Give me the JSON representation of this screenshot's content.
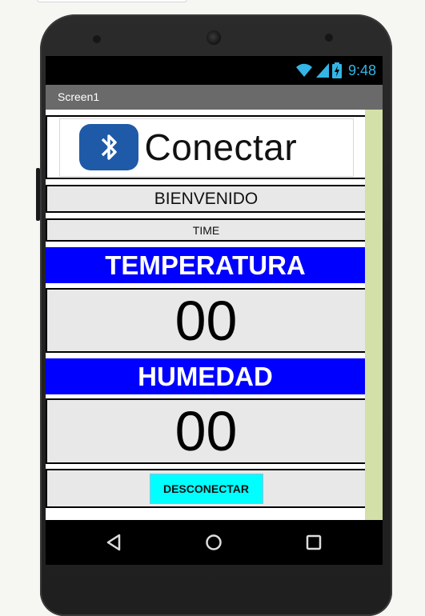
{
  "status_bar": {
    "time": "9:48",
    "icons": [
      "wifi-icon",
      "signal-icon",
      "battery-charging-icon"
    ]
  },
  "title_bar": {
    "title": "Screen1"
  },
  "connect": {
    "label": "Conectar",
    "icon": "bluetooth-icon"
  },
  "welcome": {
    "text": "BIENVENIDO"
  },
  "time_label": {
    "text": "TIME"
  },
  "temperature": {
    "header": "TEMPERATURA",
    "value": "00"
  },
  "humidity": {
    "header": "HUMEDAD",
    "value": "00"
  },
  "disconnect": {
    "label": "DESCONECTAR"
  },
  "nav": {
    "buttons": [
      "back-icon",
      "home-icon",
      "recents-icon"
    ]
  },
  "colors": {
    "header_blue": "#0000ff",
    "button_cyan": "#00ffff",
    "scroll_strip": "#d3e0a8",
    "title_bar": "#6a6a6a",
    "status_accent": "#33b5e5"
  }
}
